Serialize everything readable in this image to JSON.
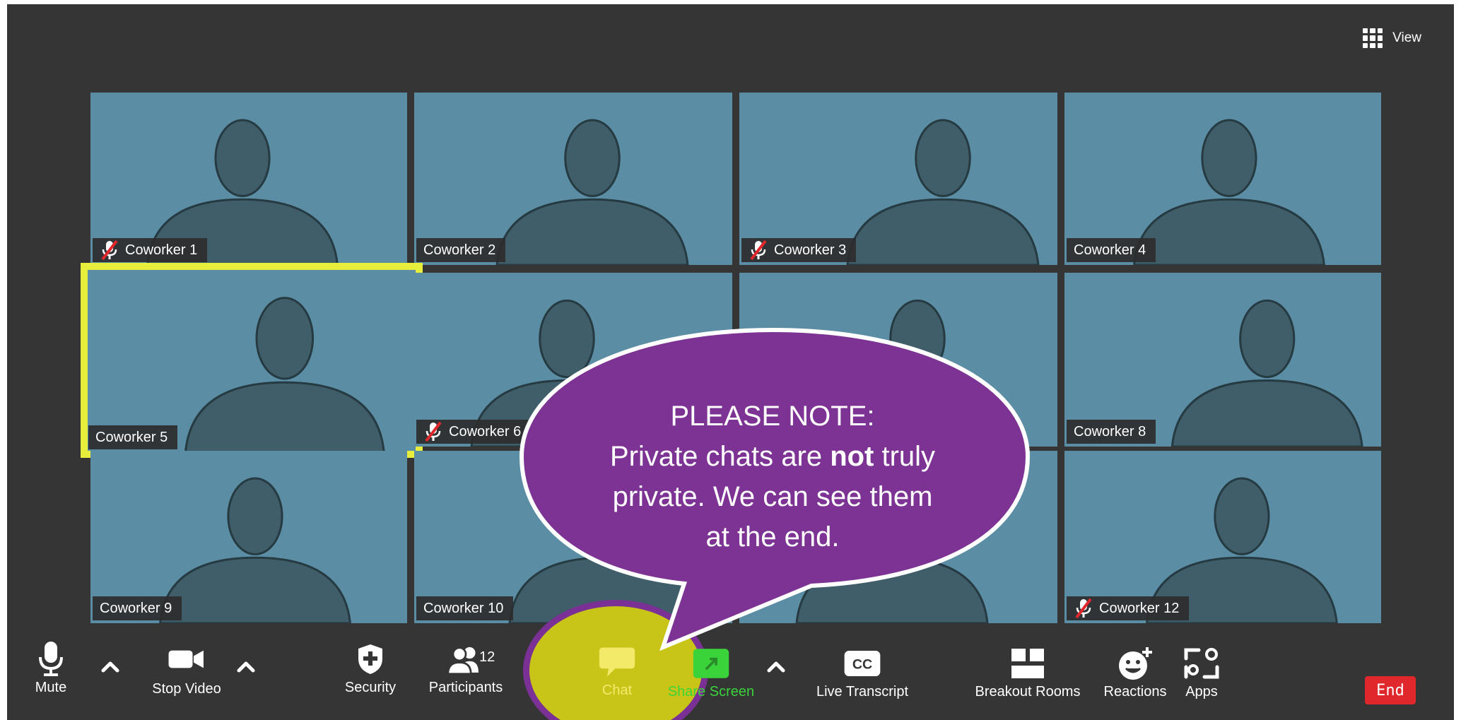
{
  "view": {
    "label": "View"
  },
  "tiles": [
    {
      "name": "Coworker 1",
      "muted": true,
      "active": false
    },
    {
      "name": "Coworker 2",
      "muted": false,
      "active": false
    },
    {
      "name": "Coworker 3",
      "muted": true,
      "active": false
    },
    {
      "name": "Coworker 4",
      "muted": false,
      "active": false
    },
    {
      "name": "Coworker 5",
      "muted": false,
      "active": true
    },
    {
      "name": "Coworker 6",
      "muted": true,
      "active": false
    },
    {
      "name": "",
      "muted": false,
      "active": false
    },
    {
      "name": "Coworker 8",
      "muted": false,
      "active": false
    },
    {
      "name": "Coworker 9",
      "muted": false,
      "active": false
    },
    {
      "name": "Coworker 10",
      "muted": false,
      "active": false
    },
    {
      "name": "",
      "muted": false,
      "active": false
    },
    {
      "name": "Coworker 12",
      "muted": true,
      "active": false
    }
  ],
  "callout": {
    "line1": "PLEASE NOTE:",
    "line2_pre": "Private chats are ",
    "line2_bold": "not",
    "line2_post": " truly",
    "line3": "private. We can see them",
    "line4": "at the end."
  },
  "toolbar": {
    "mute": "Mute",
    "stop_video": "Stop Video",
    "security": "Security",
    "participants": "Participants",
    "participants_count": "12",
    "chat": "Chat",
    "share_screen": "Share Screen",
    "live_transcript": "Live Transcript",
    "breakout_rooms": "Breakout Rooms",
    "reactions": "Reactions",
    "apps": "Apps",
    "end": "End"
  },
  "colors": {
    "background": "#353535",
    "tile": "#5b8ea4",
    "active_border": "#e8ee3c",
    "callout_fill": "#7d3394",
    "chat_highlight": "#c9c518",
    "end_button": "#e0282c"
  }
}
